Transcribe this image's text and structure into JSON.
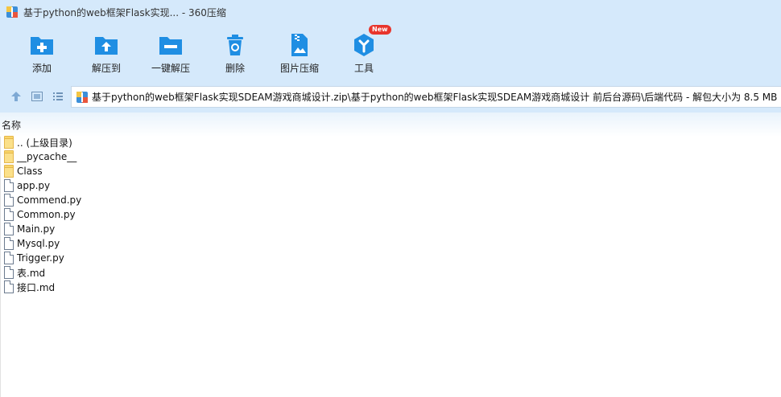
{
  "window": {
    "title": "基于python的web框架Flask实现... - 360压缩"
  },
  "toolbar": {
    "items": [
      {
        "label": "添加",
        "icon": "folder-add-icon"
      },
      {
        "label": "解压到",
        "icon": "folder-extract-icon"
      },
      {
        "label": "一键解压",
        "icon": "folder-minus-icon"
      },
      {
        "label": "删除",
        "icon": "trash-icon"
      },
      {
        "label": "图片压缩",
        "icon": "image-compress-icon"
      },
      {
        "label": "工具",
        "icon": "tools-icon",
        "badge": "New"
      }
    ]
  },
  "address": {
    "path": "基于python的web框架Flask实现SDEAM游戏商城设计.zip\\基于python的web框架Flask实现SDEAM游戏商城设计 前后台源码\\后端代码 - 解包大小为 8.5 MB"
  },
  "list": {
    "column_name": "名称",
    "items": [
      {
        "name": ".. (上级目录)",
        "type": "folder"
      },
      {
        "name": "__pycache__",
        "type": "folder"
      },
      {
        "name": "Class",
        "type": "folder"
      },
      {
        "name": "app.py",
        "type": "file"
      },
      {
        "name": "Commend.py",
        "type": "file"
      },
      {
        "name": "Common.py",
        "type": "file"
      },
      {
        "name": "Main.py",
        "type": "file"
      },
      {
        "name": "Mysql.py",
        "type": "file"
      },
      {
        "name": "Trigger.py",
        "type": "file"
      },
      {
        "name": "表.md",
        "type": "file"
      },
      {
        "name": "接口.md",
        "type": "file"
      }
    ]
  },
  "colors": {
    "chrome_bg": "#d5e9fb",
    "icon_blue": "#1f8ee3",
    "badge_red": "#e8352c",
    "folder_yellow": "#f9d66b"
  }
}
